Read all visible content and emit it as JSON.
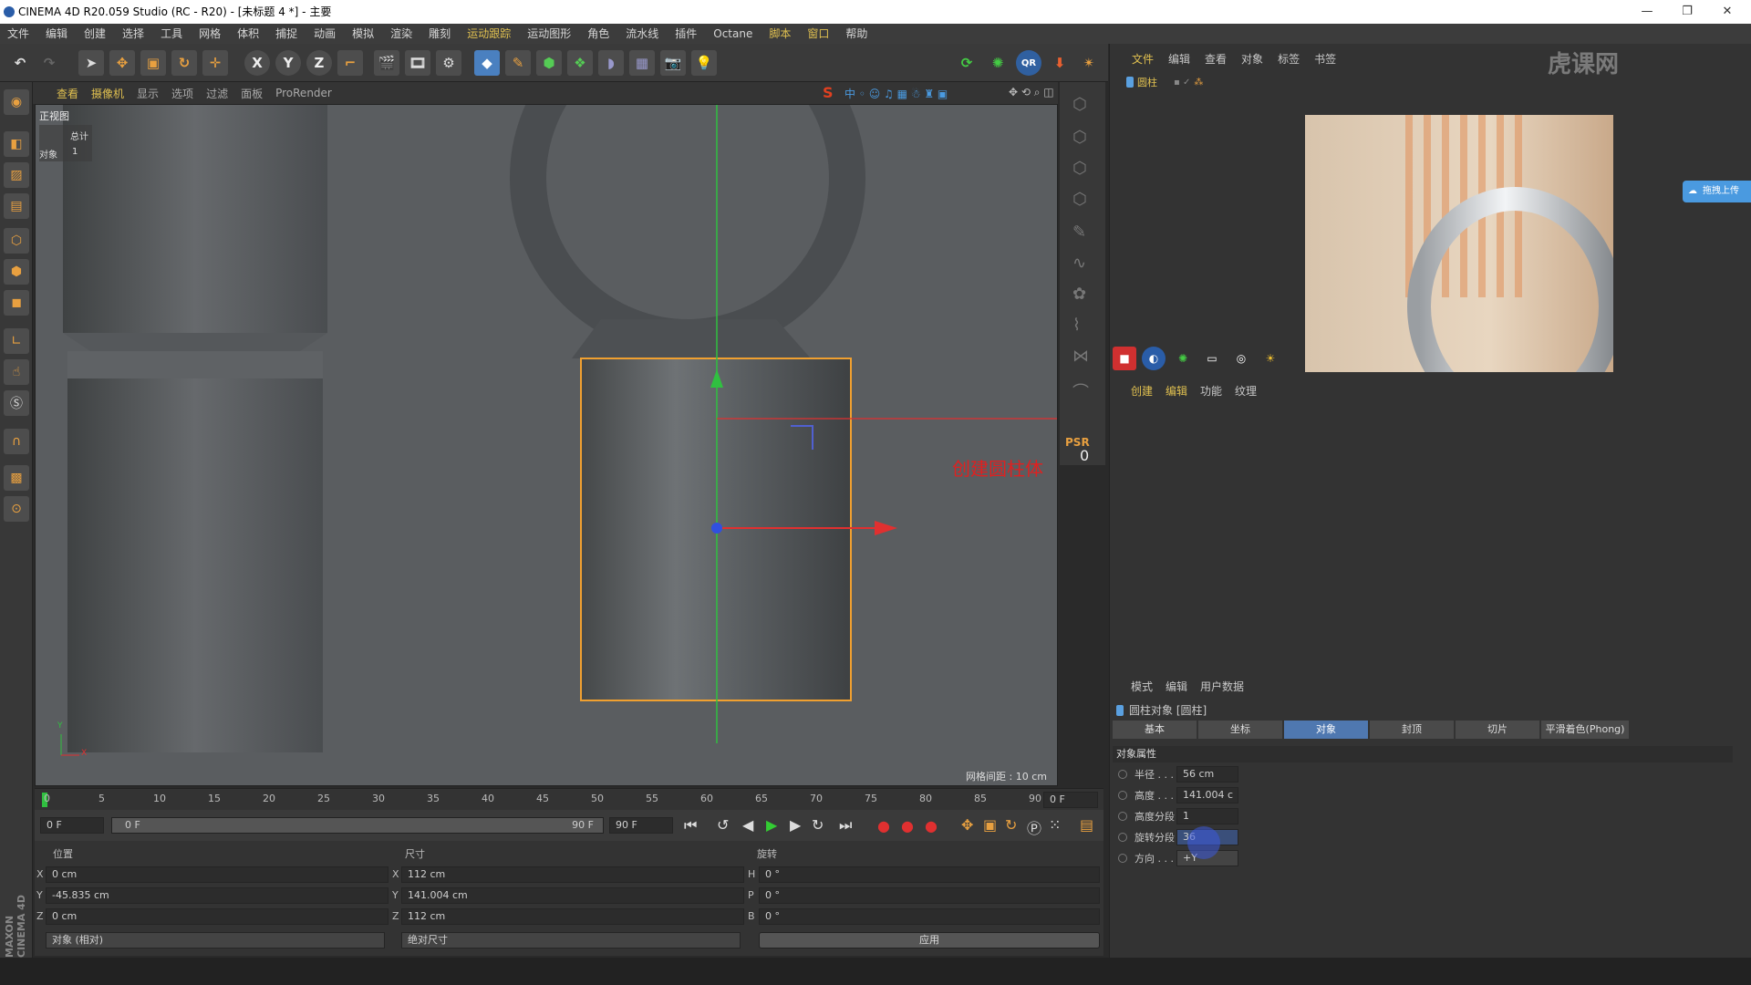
{
  "window": {
    "title": "CINEMA 4D R20.059 Studio (RC - R20) - [未标题 4 *] - 主要"
  },
  "menu": [
    "文件",
    "编辑",
    "创建",
    "选择",
    "工具",
    "网格",
    "体积",
    "捕捉",
    "动画",
    "模拟",
    "渲染",
    "雕刻",
    "运动跟踪",
    "运动图形",
    "角色",
    "流水线",
    "插件",
    "Octane",
    "脚本",
    "窗口",
    "帮助"
  ],
  "toolbar": {
    "axis_x": "X",
    "axis_y": "Y",
    "axis_z": "Z",
    "qr_label": "QR"
  },
  "viewport": {
    "menu": [
      "查看",
      "摄像机",
      "显示",
      "选项",
      "过滤",
      "面板",
      "ProRender"
    ],
    "view_name": "正视图",
    "stats_total_label": "总计",
    "stats_object_label": "对象",
    "stats_object_value": "1",
    "annotation": "创建圆柱体",
    "grid_spacing": "网格间距 : 10 cm",
    "axis_y_label": "Y",
    "axis_x_label": "X",
    "psr_label": "PSR",
    "psr_value": "0"
  },
  "timeline": {
    "ticks": [
      "0",
      "5",
      "10",
      "15",
      "20",
      "25",
      "30",
      "35",
      "40",
      "45",
      "50",
      "55",
      "60",
      "65",
      "70",
      "75",
      "80",
      "85",
      "90"
    ],
    "current_frame": "0 F",
    "start_frame": "0 F",
    "range_start": "0 F",
    "range_end": "90 F",
    "end_frame": "90 F"
  },
  "coordinates": {
    "position_header": "位置",
    "size_header": "尺寸",
    "rotation_header": "旋转",
    "pos_x": "0 cm",
    "pos_y": "-45.835 cm",
    "pos_z": "0 cm",
    "size_x": "112 cm",
    "size_y": "141.004 cm",
    "size_z": "112 cm",
    "rot_h": "0 °",
    "rot_p": "0 °",
    "rot_b": "0 °",
    "mode_select": "对象 (相对)",
    "size_select": "绝对尺寸",
    "apply_button": "应用",
    "label_x": "X",
    "label_y": "Y",
    "label_z": "Z",
    "label_h": "H",
    "label_p": "P",
    "label_b": "B"
  },
  "object_manager": {
    "menu": [
      "文件",
      "编辑",
      "查看",
      "对象",
      "标签",
      "书签"
    ],
    "object_name": "圆柱"
  },
  "material_panel": {
    "menu": [
      "创建",
      "编辑",
      "功能",
      "纹理"
    ]
  },
  "attributes": {
    "menu": [
      "模式",
      "编辑",
      "用户数据"
    ],
    "object_title": "圆柱对象 [圆柱]",
    "tabs": [
      "基本",
      "坐标",
      "对象",
      "封顶",
      "切片",
      "平滑着色(Phong)"
    ],
    "active_tab": "对象",
    "section": "对象属性",
    "props": [
      {
        "label": "半径 . . .",
        "value": "56 cm"
      },
      {
        "label": "高度 . . .",
        "value": "141.004 c"
      },
      {
        "label": "高度分段",
        "value": "1"
      },
      {
        "label": "旋转分段",
        "value": "36"
      },
      {
        "label": "方向 . . .",
        "value": "+Y"
      }
    ]
  },
  "side_badge": "拖拽上传",
  "brand_watermark": "虎课网",
  "vertical_brand": "MAXON CINEMA 4D",
  "colors": {
    "selection": "#f0a030",
    "axis_x": "#e03030",
    "axis_y": "#30c040",
    "annotation": "#e02020",
    "active_tab": "#4f78b0"
  }
}
